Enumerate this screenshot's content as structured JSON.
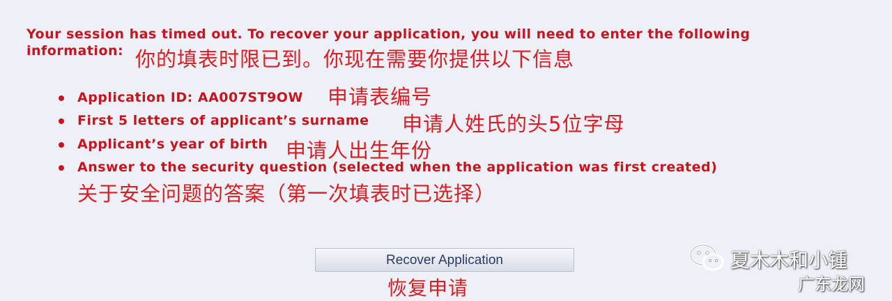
{
  "message": {
    "line1": "Your session has timed out. To recover your application, you will need to enter the following",
    "line2": "information:",
    "zh": "你的填表时限已到。你现在需要你提供以下信息"
  },
  "items": [
    {
      "en": "Application ID: AA007ST9OW",
      "zh": "申请表编号"
    },
    {
      "en": "First 5 letters of applicant’s surname",
      "zh": "申请人姓氏的头5位字母"
    },
    {
      "en": "Applicant’s year of birth",
      "zh": "申请人出生年份"
    },
    {
      "en": "Answer to the security question (selected when the application was first created)",
      "zh": "关于安全问题的答案（第一次填表时已选择）"
    }
  ],
  "button": {
    "label": "Recover Application",
    "zh": "恢复申请"
  },
  "watermark": {
    "icon": "wechat-icon",
    "account": "夏木木和小锺",
    "site": "广东龙网"
  },
  "colors": {
    "text": "#c8141e",
    "background": "#eef0f8"
  }
}
